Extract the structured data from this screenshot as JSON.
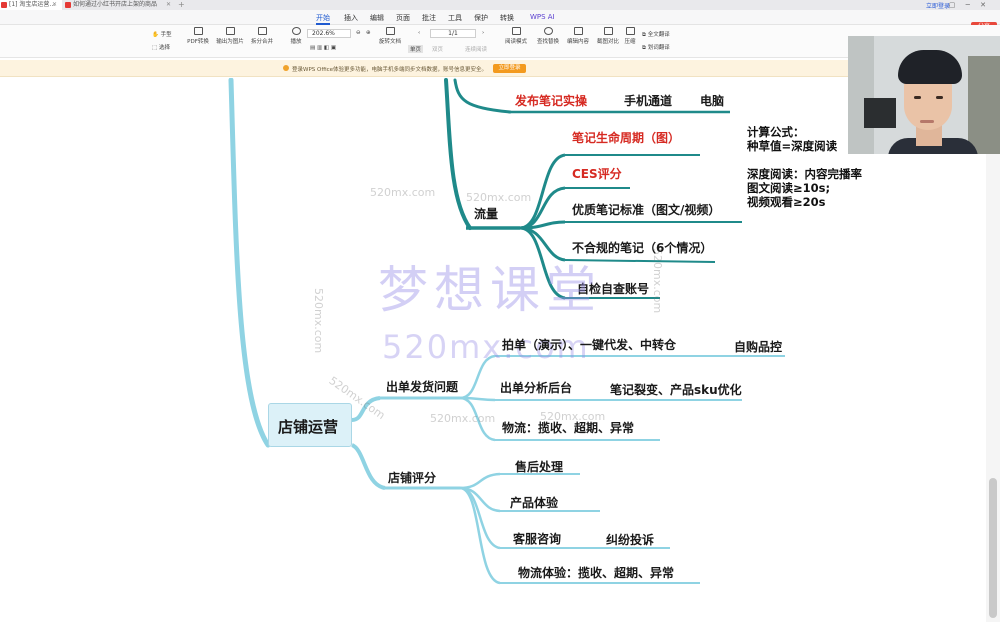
{
  "tabs": [
    {
      "label": "[1] 淘宝店运营...",
      "color": "#e53935"
    },
    {
      "label": "如何通过小红书开店上架的商品",
      "color": "#e53935"
    }
  ],
  "window": {
    "login_label": "立即登录",
    "share_label": "分享"
  },
  "menu": {
    "items": [
      "开始",
      "插入",
      "编辑",
      "页面",
      "批注",
      "工具",
      "保护",
      "转换",
      "WPS AI"
    ],
    "active": "开始"
  },
  "toolbar": {
    "hand_label": "手型",
    "select_label": "选择",
    "pdf_convert_label": "PDF转换",
    "export_image_label": "输出为图片",
    "split_merge_label": "拆分合并",
    "play_label": "播放",
    "zoom_value": "202.6%",
    "rotate_label": "旋转文档",
    "single_page_label": "单页",
    "double_page_label": "双页",
    "continuous_label": "连续阅读",
    "page_value": "1/1",
    "read_mode_label": "阅读模式",
    "find_replace_label": "查找替换",
    "edit_content_label": "编辑内容",
    "screenshot_label": "截图对比",
    "compress_label": "压缩",
    "full_translate_label": "全文翻译",
    "translate_label": "划词翻译"
  },
  "notice": {
    "text": "登录WPS Office体验更多功能，电脑手机多端同步文档数据，账号信息更安全。",
    "button_label": "立即登录"
  },
  "mindmap": {
    "root": "店铺运营",
    "traffic": {
      "label": "流量",
      "children": [
        "笔记生命周期（图）",
        "CES评分",
        "优质笔记标准（图文/视频）",
        "不合规的笔记（6个情况）",
        "自检自查账号"
      ]
    },
    "publish": {
      "label": "发布笔记实操",
      "phone": "手机通道",
      "pc": "电脑"
    },
    "shipping": {
      "label": "出单发货问题",
      "children": [
        "拍单（演示）、一键代发、中转仓",
        "出单分析后台",
        "物流：揽收、超期、异常"
      ],
      "self_purchase": "自购品控",
      "note_sku": "笔记裂变、产品sku优化"
    },
    "rating": {
      "label": "店铺评分",
      "children": [
        "售后处理",
        "产品体验",
        "客服咨询",
        "物流体验：揽收、超期、异常"
      ],
      "complaint": "纠纷投诉"
    }
  },
  "notes": {
    "formula_title": "计算公式：",
    "formula_line": "种草值=深度阅读",
    "deep_read_title": "深度阅读：内容完播率",
    "image_text": "图文阅读≥10s;",
    "video_text": "视频观看≥20s"
  },
  "watermark": {
    "big": "梦想课堂",
    "url": "520mx.com",
    "small": "520mx.com"
  },
  "colors": {
    "branch": "#1f8a8a",
    "branch_light": "#8fd3e3",
    "red": "#d62a22",
    "accent": "#1f5ad0"
  }
}
